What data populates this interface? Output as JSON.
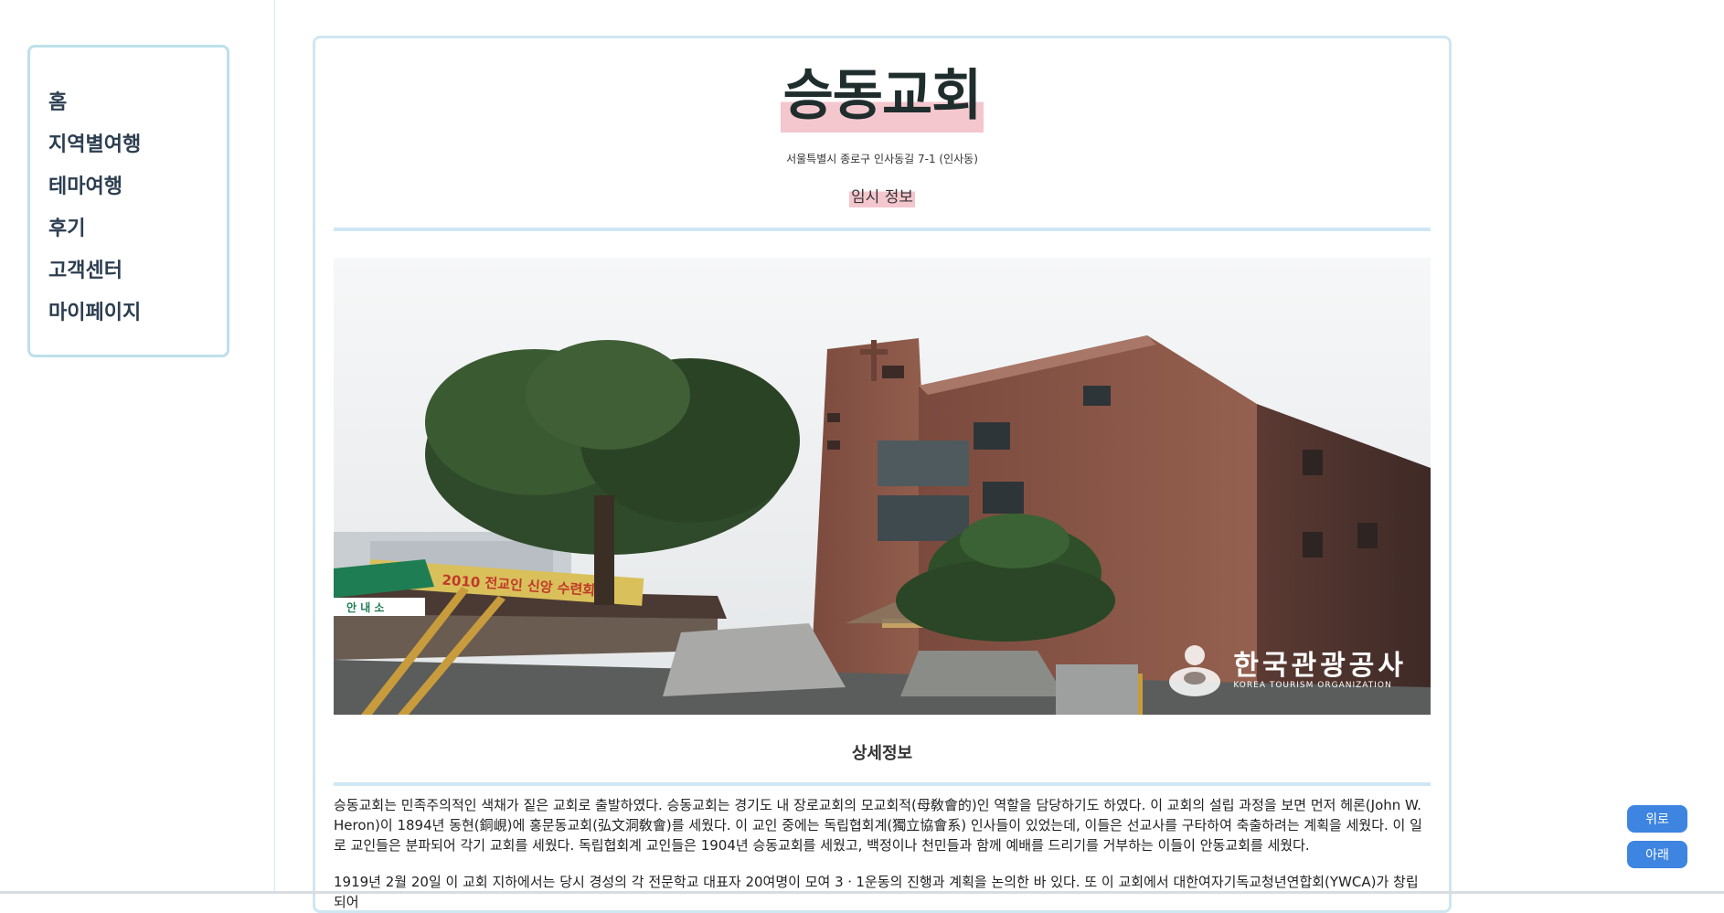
{
  "nav": {
    "items": [
      {
        "label": "홈"
      },
      {
        "label": "지역별여행"
      },
      {
        "label": "테마여행"
      },
      {
        "label": "후기"
      },
      {
        "label": "고객센터"
      },
      {
        "label": "마이페이지"
      }
    ]
  },
  "place": {
    "title": "승동교회",
    "address": "서울특별시 종로구 인사동길 7-1 (인사동)",
    "temp_info_label": "임시 정보"
  },
  "photo": {
    "banner_text": "2010 전교인 신앙 수련회",
    "tent_text": "안 내 소",
    "watermark_name": "한국관광공사",
    "watermark_sub": "KOREA TOURISM ORGANIZATION"
  },
  "detail": {
    "heading": "상세정보",
    "paragraphs": [
      "승동교회는 민족주의적인 색채가 짙은 교회로 출발하였다. 승동교회는 경기도 내 장로교회의 모교회적(母敎會的)인 역할을 담당하기도 하였다. 이 교회의 설립 과정을 보면 먼저 헤론(John W. Heron)이 1894년 동현(銅峴)에 홍문동교회(弘文洞敎會)를 세웠다. 이 교인 중에는 독립협회계(獨立協會系) 인사들이 있었는데, 이들은 선교사를 구타하여 축출하려는 계획을 세웠다. 이 일로 교인들은 분파되어 각기 교회를 세웠다. 독립협회계 교인들은 1904년 승동교회를 세웠고, 백정이나 천민들과 함께 예배를 드리기를 거부하는 이들이 안동교회를 세웠다.",
      "1919년 2월 20일 이 교회 지하에서는 당시 경성의 각 전문학교 대표자 20여명이 모여 3ㆍ1운동의 진행과 계획을 논의한 바 있다. 또 이 교회에서 대한여자기독교청년연합회(YWCA)가 창립되어"
    ]
  },
  "float_buttons": {
    "up_label": "위로",
    "down_label": "아래"
  },
  "colors": {
    "accent_blue": "#3d85e0",
    "card_border": "#cfe7f2",
    "nav_border": "#bde0ea",
    "highlight_pink": "#f4c7cf",
    "text_dark": "#2c3e50"
  }
}
